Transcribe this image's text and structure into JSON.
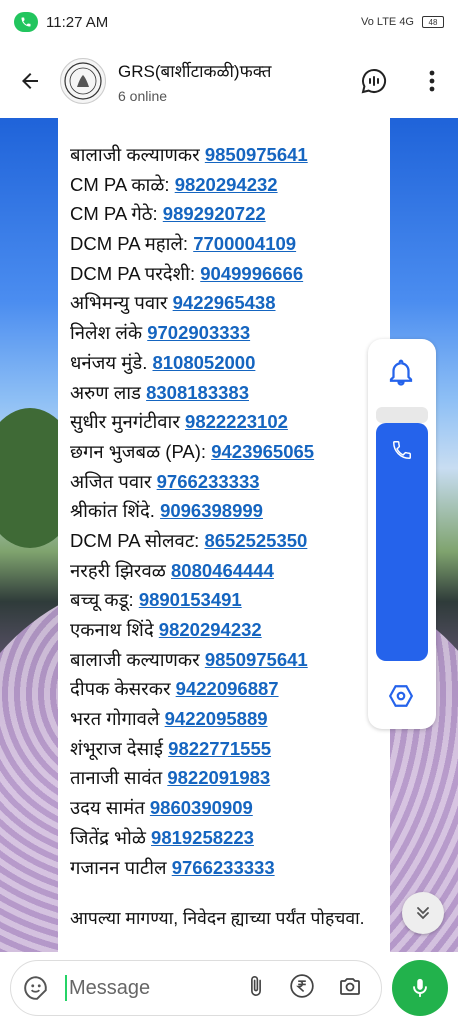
{
  "status": {
    "time": "11:27 AM",
    "network": "Vo LTE 4G",
    "battery": "48"
  },
  "header": {
    "title": "GRS(बार्शीटाकळी)फक्त",
    "subtitle": "6 online"
  },
  "contacts": [
    {
      "name": "बालाजी कल्याणकर ",
      "phone": "9850975641"
    },
    {
      "name": "CM PA काळे: ",
      "phone": "9820294232"
    },
    {
      "name": "CM PA गेठे: ",
      "phone": "9892920722"
    },
    {
      "name": "DCM PA महाले: ",
      "phone": "7700004109"
    },
    {
      "name": "DCM PA परदेशी: ",
      "phone": "9049996666"
    },
    {
      "name": "अभिमन्यु पवार ",
      "phone": "9422965438"
    },
    {
      "name": "निलेश लंके ",
      "phone": "9702903333"
    },
    {
      "name": "धनंजय मुंडे. ",
      "phone": "8108052000"
    },
    {
      "name": "अरुण लाड  ",
      "phone": "8308183383"
    },
    {
      "name": "सुधीर मुनगंटीवार ",
      "phone": "9822223102"
    },
    {
      "name": "छगन भुजबळ (PA): ",
      "phone": "9423965065"
    },
    {
      "name": "अजित पवार ",
      "phone": "9766233333"
    },
    {
      "name": "श्रीकांत शिंदे. ",
      "phone": "9096398999"
    },
    {
      "name": "DCM PA सोलवट: ",
      "phone": "8652525350"
    },
    {
      "name": "नरहरी झिरवळ ",
      "phone": "8080464444"
    },
    {
      "name": "बच्चू कडू: ",
      "phone": "9890153491"
    },
    {
      "name": "एकनाथ शिंदे ",
      "phone": "9820294232"
    },
    {
      "name": "बालाजी कल्याणकर ",
      "phone": "9850975641"
    },
    {
      "name": "दीपक केसरकर ",
      "phone": "9422096887"
    },
    {
      "name": "भरत गोगावले ",
      "phone": "9422095889"
    },
    {
      "name": "शंभूराज देसाई ",
      "phone": "9822771555"
    },
    {
      "name": "तानाजी सावंत ",
      "phone": "9822091983"
    },
    {
      "name": "उदय सामंत ",
      "phone": "9860390909"
    },
    {
      "name": "जितेंद्र भोळे  ",
      "phone": "9819258223"
    },
    {
      "name": "गजानन पाटील ",
      "phone": "9766233333"
    }
  ],
  "footer_text": "आपल्या मागण्या, निवेदन ह्याच्या पर्यंत पोहचवा.",
  "composer": {
    "placeholder": "Message"
  },
  "colors": {
    "accent_green": "#22b24c",
    "link_blue": "#1565c0",
    "panel_blue": "#2563eb"
  },
  "icons": [
    "call-icon",
    "back-arrow-icon",
    "group-logo",
    "voice-chat-icon",
    "more-options-icon",
    "bell-icon",
    "phone-icon",
    "hexagon-icon",
    "double-chevron-down-icon",
    "sticker-icon",
    "attach-icon",
    "rupee-icon",
    "camera-icon",
    "mic-icon"
  ]
}
